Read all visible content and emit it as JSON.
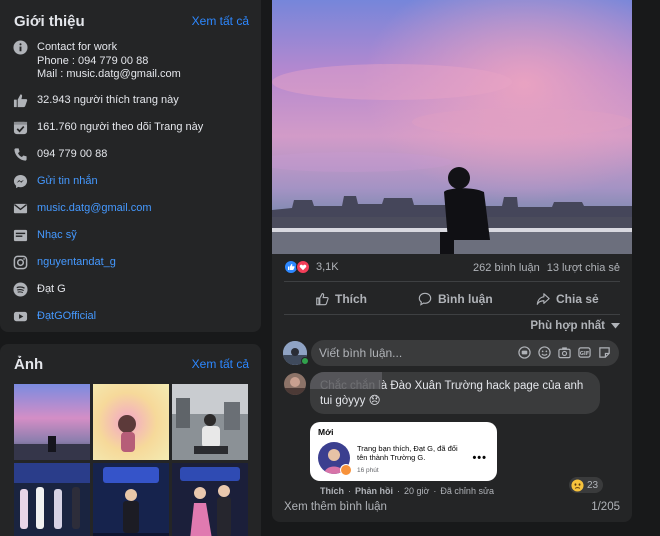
{
  "intro": {
    "title": "Giới thiệu",
    "see_all": "Xem tất cả",
    "contact_lines": [
      "Contact for work",
      "Phone : 094 779 00 88",
      "Mail : music.datg@gmail.com"
    ],
    "likes": "32.943 người thích trang này",
    "followers": "161.760 người theo dõi Trang này",
    "phone": "094 779 00 88",
    "send_message": "Gửi tin nhắn",
    "email": "music.datg@gmail.com",
    "category": "Nhạc sỹ",
    "instagram": "nguyentandat_g",
    "spotify": "Đạt G",
    "youtube": "ĐạtGOfficial"
  },
  "photos": {
    "title": "Ảnh",
    "see_all": "Xem tất cả"
  },
  "post": {
    "reaction_count": "3,1K",
    "comments_count": "262 bình luận",
    "shares_count": "13 lượt chia sẻ",
    "actions": {
      "like": "Thích",
      "comment": "Bình luận",
      "share": "Chia sẻ"
    },
    "sort_label": "Phù hợp nhất",
    "comment_placeholder": "Viết bình luận...",
    "comment": {
      "text": "Chắc chắn là Đào Xuân Trường hack page của anh tui gòyyy 😞",
      "reaction_count": "23",
      "like": "Thích",
      "reply": "Phản hồi",
      "time": "20 giờ",
      "edited": "Đã chỉnh sửa"
    },
    "notification": {
      "heading": "Mới",
      "text": "Trang bạn thích, Đạt G, đã đổi tên thành Trường G.",
      "time": "16 phút"
    },
    "more_comments": "Xem thêm bình luận",
    "comment_pager": "1/205"
  },
  "colors": {
    "background": "#18191a",
    "card": "#242526",
    "link": "#2d88ff",
    "muted": "#b0b3b8"
  }
}
